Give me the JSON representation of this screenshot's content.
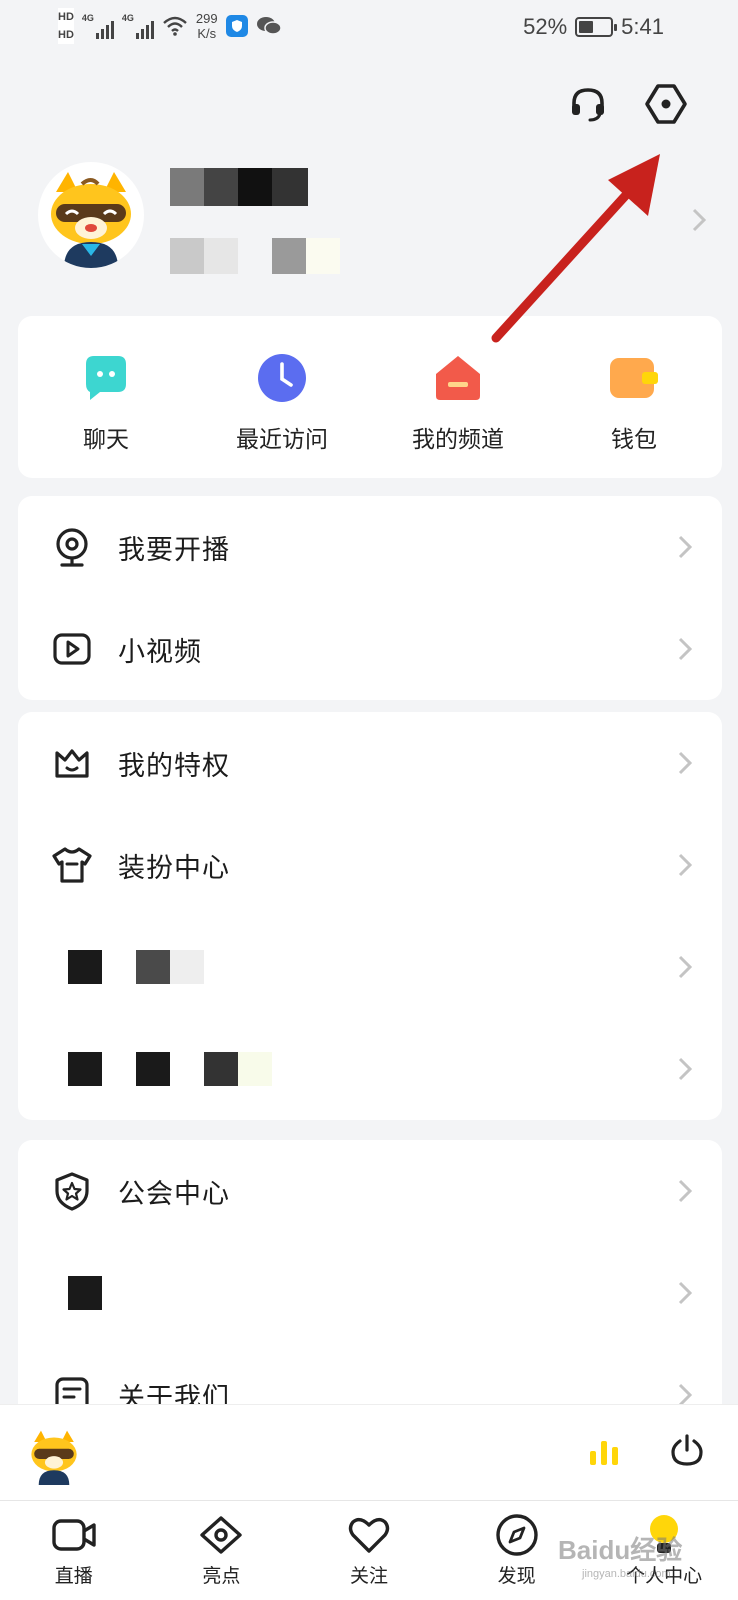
{
  "status_bar": {
    "hd1": "HD",
    "hd2": "HD",
    "net1": "4G",
    "net2": "4G",
    "speed_value": "299",
    "speed_unit": "K/s",
    "battery_percent": "52%",
    "battery_level": 0.52,
    "time": "5:41"
  },
  "header": {
    "support_icon": "headset-icon",
    "settings_icon": "hexagon-settings-icon"
  },
  "quick_actions": [
    {
      "label": "聊天",
      "icon": "chat-bubble-icon",
      "color": "#3dd6d0"
    },
    {
      "label": "最近访问",
      "icon": "clock-icon",
      "color": "#5b6df0"
    },
    {
      "label": "我的频道",
      "icon": "channel-house-icon",
      "color": "#f25a4a"
    },
    {
      "label": "钱包",
      "icon": "wallet-icon",
      "color": "#ffa94d"
    }
  ],
  "menu_group_1": [
    {
      "label": "我要开播",
      "icon": "webcam-icon"
    },
    {
      "label": "小视频",
      "icon": "video-play-icon"
    }
  ],
  "menu_group_2": [
    {
      "label": "我的特权",
      "icon": "crown-icon"
    },
    {
      "label": "装扮中心",
      "icon": "tshirt-icon"
    }
  ],
  "menu_group_3": [
    {
      "label": "公会中心",
      "icon": "shield-star-icon"
    },
    {
      "label": "关于我们",
      "icon": "document-icon"
    }
  ],
  "bottom_nav": [
    {
      "label": "直播",
      "icon": "video-camera-icon"
    },
    {
      "label": "亮点",
      "icon": "eye-icon"
    },
    {
      "label": "关注",
      "icon": "heart-icon"
    },
    {
      "label": "发现",
      "icon": "compass-icon"
    },
    {
      "label": "个人中心",
      "icon": "bulb-avatar-icon"
    }
  ],
  "watermark": {
    "main": "Baidu经验",
    "sub": "jingyan.baidu.com"
  },
  "colors": {
    "accent_yellow": "#ffd60a",
    "arrow_red": "#c8221d"
  }
}
